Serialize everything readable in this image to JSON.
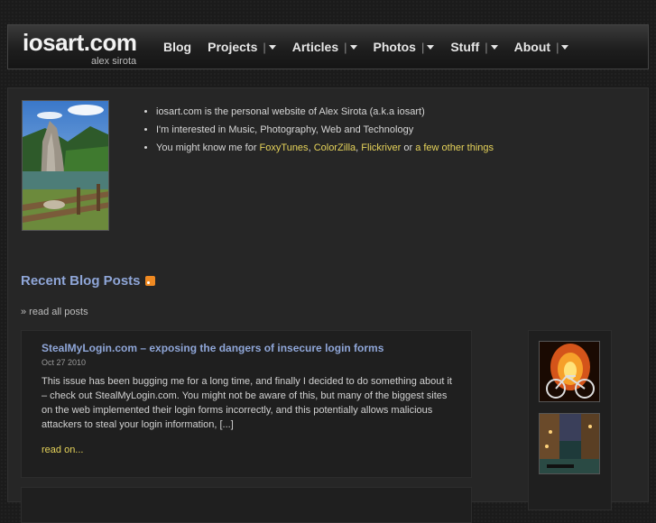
{
  "header": {
    "logo_title": "iosart.com",
    "logo_subtitle": "alex sirota",
    "nav": [
      {
        "label": "Blog",
        "has_menu": false
      },
      {
        "label": "Projects",
        "has_menu": true
      },
      {
        "label": "Articles",
        "has_menu": true
      },
      {
        "label": "Photos",
        "has_menu": true
      },
      {
        "label": "Stuff",
        "has_menu": true
      },
      {
        "label": "About",
        "has_menu": true
      }
    ],
    "separator": "|"
  },
  "intro": {
    "line1": "iosart.com is the personal website of Alex Sirota (a.k.a iosart)",
    "line2": "I'm interested in Music, Photography, Web and Technology",
    "line3_prefix": "You might know me for ",
    "link_foxytunes": "FoxyTunes",
    "comma1": ", ",
    "link_colorzilla": "ColorZilla",
    "comma2": ", ",
    "link_flickriver": "Flickriver",
    "or_text": " or ",
    "link_other": "a few other things"
  },
  "blog": {
    "section_title": "Recent Blog Posts",
    "read_all": "» read all posts",
    "post": {
      "title": "StealMyLogin.com – exposing the dangers of insecure login forms",
      "date": "Oct 27 2010",
      "body": "This issue has been bugging me for a long time, and finally I decided to do something about it – check out StealMyLogin.com. You might not be aware of this, but many of the biggest sites on the web implemented their login forms incorrectly, and this potentially allows malicious attackers to steal your login information, [...]",
      "read_more": "read on..."
    }
  },
  "colors": {
    "accent_blue": "#8fa6d8",
    "accent_yellow": "#e6d35a",
    "background": "#1b1b1b"
  }
}
